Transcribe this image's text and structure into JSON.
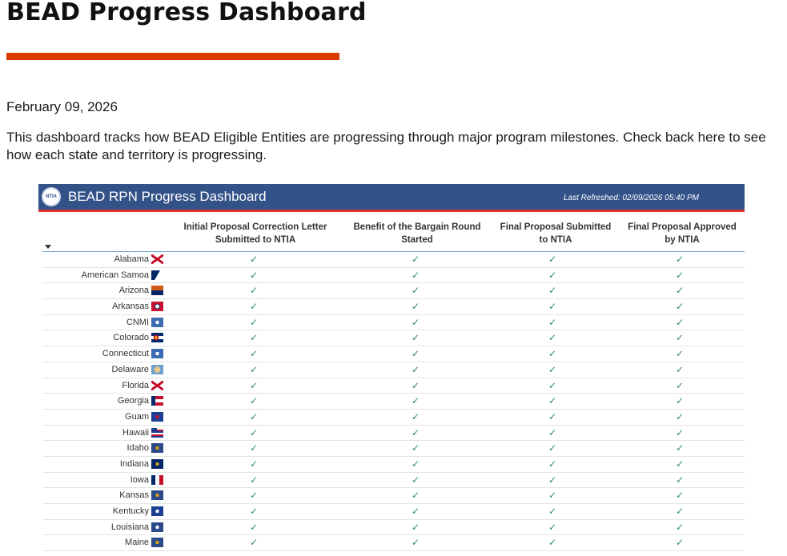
{
  "page": {
    "title": "BEAD Progress Dashboard",
    "date": "February 09, 2026",
    "intro": "This dashboard tracks how BEAD Eligible Entities are progressing through major program milestones. Check back here to see how each state and territory is progressing."
  },
  "embed": {
    "logo_text": "NTIA",
    "title": "BEAD RPN Progress Dashboard",
    "refresh": "Last Refreshed: 02/09/2026 05:40 PM",
    "columns": [
      {
        "line1": "Initial Proposal Correction Letter",
        "line2": "Submitted to NTIA"
      },
      {
        "line1": "Benefit of the Bargain Round",
        "line2": "Started"
      },
      {
        "line1": "Final Proposal Submitted",
        "line2": "to NTIA"
      },
      {
        "line1": "Final Proposal Approved",
        "line2": "by NTIA"
      }
    ],
    "check_glyph": "✓",
    "rows": [
      {
        "name": "Alabama",
        "flag": [
          "#ffffff",
          "#c8102e"
        ],
        "style": "saltire"
      },
      {
        "name": "American Samoa",
        "flag": [
          "#002868",
          "#ffffff"
        ],
        "style": "triangle"
      },
      {
        "name": "Arizona",
        "flag": [
          "#ce5c17",
          "#002868"
        ],
        "style": "rays"
      },
      {
        "name": "Arkansas",
        "flag": [
          "#c8102e",
          "#002868"
        ],
        "style": "diamond"
      },
      {
        "name": "CNMI",
        "flag": [
          "#3d6bb3",
          "#ffffff"
        ],
        "style": "seal"
      },
      {
        "name": "Colorado",
        "flag": [
          "#002868",
          "#c8102e"
        ],
        "style": "stripesC"
      },
      {
        "name": "Connecticut",
        "flag": [
          "#3d6bb3",
          "#ffffff"
        ],
        "style": "seal"
      },
      {
        "name": "Delaware",
        "flag": [
          "#6d9fd1",
          "#e8c98a"
        ],
        "style": "diamondseal"
      },
      {
        "name": "Florida",
        "flag": [
          "#ffffff",
          "#c8102e"
        ],
        "style": "saltire"
      },
      {
        "name": "Georgia",
        "flag": [
          "#002868",
          "#c8102e"
        ],
        "style": "bars"
      },
      {
        "name": "Guam",
        "flag": [
          "#1c3f94",
          "#c8102e"
        ],
        "style": "seal"
      },
      {
        "name": "Hawaii",
        "flag": [
          "#c8102e",
          "#ffffff"
        ],
        "style": "hawaii"
      },
      {
        "name": "Idaho",
        "flag": [
          "#2a4a8a",
          "#d4a017"
        ],
        "style": "seal"
      },
      {
        "name": "Indiana",
        "flag": [
          "#002868",
          "#d4a017"
        ],
        "style": "seal"
      },
      {
        "name": "Iowa",
        "flag": [
          "#c8102e",
          "#002868"
        ],
        "style": "iowa"
      },
      {
        "name": "Kansas",
        "flag": [
          "#2a4a8a",
          "#d4a017"
        ],
        "style": "seal"
      },
      {
        "name": "Kentucky",
        "flag": [
          "#1c3f94",
          "#ffffff"
        ],
        "style": "seal"
      },
      {
        "name": "Louisiana",
        "flag": [
          "#2a4a8a",
          "#ffffff"
        ],
        "style": "seal"
      },
      {
        "name": "Maine",
        "flag": [
          "#2a4a8a",
          "#d4a017"
        ],
        "style": "seal"
      }
    ]
  }
}
